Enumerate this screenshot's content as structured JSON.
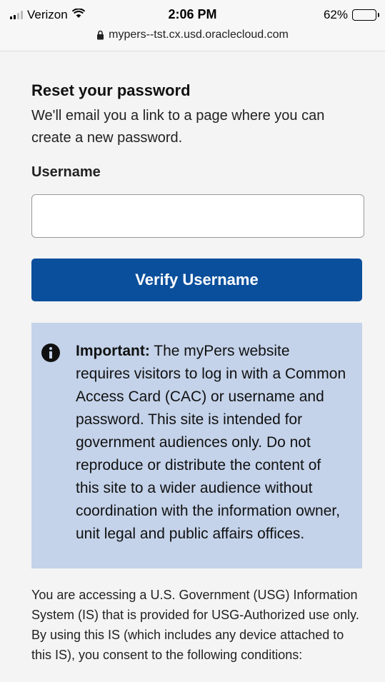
{
  "status_bar": {
    "carrier": "Verizon",
    "time": "2:06 PM",
    "battery_percent": "62%",
    "battery_level": 0.62,
    "url": "mypers--tst.cx.usd.oraclecloud.com",
    "icons": [
      "signal-icon",
      "wifi-icon",
      "lock-icon",
      "battery-icon"
    ]
  },
  "page": {
    "title": "Reset your password",
    "description": "We'll email you a link to a page where you can create a new password.",
    "username_label": "Username",
    "username_value": "",
    "verify_button": "Verify Username",
    "notice": {
      "icon": "info-icon",
      "important_label": "Important:",
      "text": " The myPers website requires visitors to log in with a Common Access Card (CAC) or username and password. This site is intended for government audiences only. Do not reproduce or distribute the content of this site to a wider audience without coordination with the information owner, unit legal and public affairs offices."
    },
    "consent_text": "You are accessing a U.S. Government (USG) Information System (IS) that is provided for USG-Authorized use only. By using this IS (which includes any device attached to this IS), you consent to the following conditions:"
  },
  "colors": {
    "button_bg": "#0a4f9c",
    "notice_bg": "#c4d3ea",
    "page_bg": "#f4f4f4"
  }
}
